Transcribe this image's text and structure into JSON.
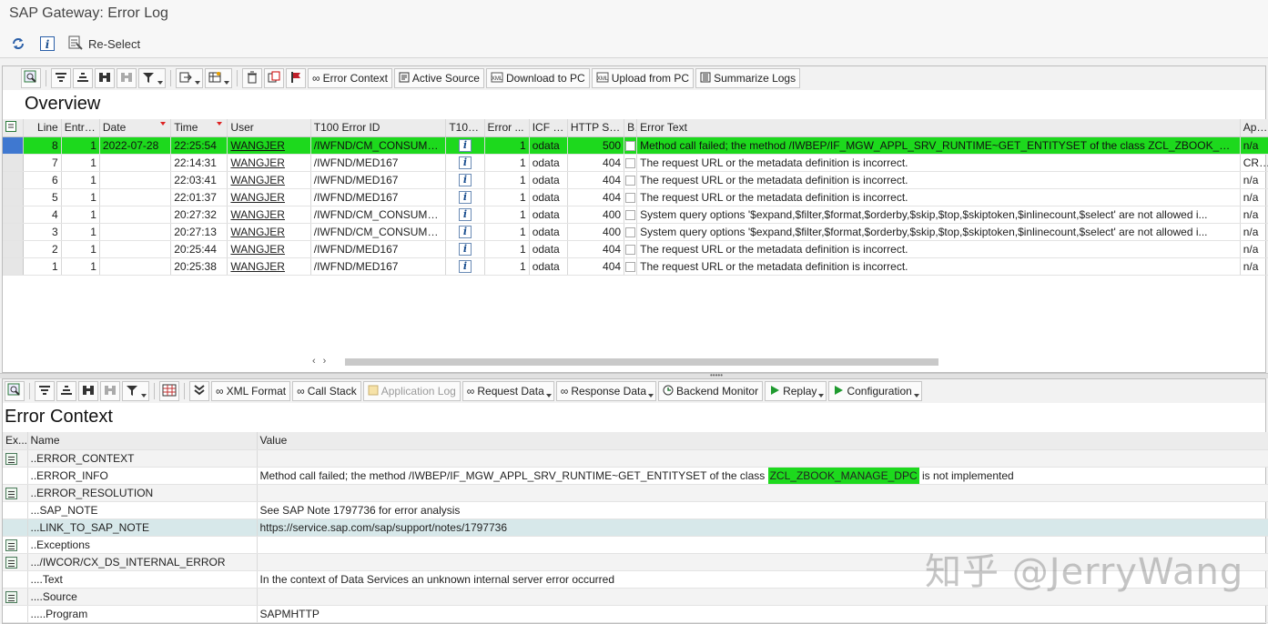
{
  "window": {
    "title": "SAP Gateway: Error Log"
  },
  "app_toolbar": {
    "reselect_label": "Re-Select"
  },
  "top_toolbar": {
    "error_context": "Error Context",
    "active_source": "Active Source",
    "download_to_pc": "Download to PC",
    "upload_from_pc": "Upload from PC",
    "summarize_logs": "Summarize Logs"
  },
  "overview": {
    "title": "Overview",
    "columns": [
      "Line",
      "Entry...",
      "Date",
      "Time",
      "User",
      "T100 Error ID",
      "T100...",
      "Error ...",
      "ICF N...",
      "HTTP St...",
      "Ba",
      "Error Text",
      "Applica"
    ],
    "rows": [
      {
        "line": "8",
        "entry": "1",
        "date": "2022-07-28",
        "time": "22:25:54",
        "user": "WANGJER",
        "t100_id": "/IWFND/CM_CONSUMER...",
        "err_no": "1",
        "icf": "odata",
        "http": "500",
        "text": "Method call failed; the method /IWBEP/IF_MGW_APPL_SRV_RUNTIME~GET_ENTITYSET of the class ZCL_ZBOOK_M...",
        "app": "n/a",
        "selected": true
      },
      {
        "line": "7",
        "entry": "1",
        "date": "",
        "time": "22:14:31",
        "user": "WANGJER",
        "t100_id": "/IWFND/MED167",
        "err_no": "1",
        "icf": "odata",
        "http": "404",
        "text": "The request URL or the metadata definition is incorrect.",
        "app": "CRM-B"
      },
      {
        "line": "6",
        "entry": "1",
        "date": "",
        "time": "22:03:41",
        "user": "WANGJER",
        "t100_id": "/IWFND/MED167",
        "err_no": "1",
        "icf": "odata",
        "http": "404",
        "text": "The request URL or the metadata definition is incorrect.",
        "app": "n/a"
      },
      {
        "line": "5",
        "entry": "1",
        "date": "",
        "time": "22:01:37",
        "user": "WANGJER",
        "t100_id": "/IWFND/MED167",
        "err_no": "1",
        "icf": "odata",
        "http": "404",
        "text": "The request URL or the metadata definition is incorrect.",
        "app": "n/a"
      },
      {
        "line": "4",
        "entry": "1",
        "date": "",
        "time": "20:27:32",
        "user": "WANGJER",
        "t100_id": "/IWFND/CM_CONSUMER...",
        "err_no": "1",
        "icf": "odata",
        "http": "400",
        "text": "System query options '$expand,$filter,$format,$orderby,$skip,$top,$skiptoken,$inlinecount,$select' are not allowed i...",
        "app": "n/a"
      },
      {
        "line": "3",
        "entry": "1",
        "date": "",
        "time": "20:27:13",
        "user": "WANGJER",
        "t100_id": "/IWFND/CM_CONSUMER...",
        "err_no": "1",
        "icf": "odata",
        "http": "400",
        "text": "System query options '$expand,$filter,$format,$orderby,$skip,$top,$skiptoken,$inlinecount,$select' are not allowed i...",
        "app": "n/a"
      },
      {
        "line": "2",
        "entry": "1",
        "date": "",
        "time": "20:25:44",
        "user": "WANGJER",
        "t100_id": "/IWFND/MED167",
        "err_no": "1",
        "icf": "odata",
        "http": "404",
        "text": "The request URL or the metadata definition is incorrect.",
        "app": "n/a"
      },
      {
        "line": "1",
        "entry": "1",
        "date": "",
        "time": "20:25:38",
        "user": "WANGJER",
        "t100_id": "/IWFND/MED167",
        "err_no": "1",
        "icf": "odata",
        "http": "404",
        "text": "The request URL or the metadata definition is incorrect.",
        "app": "n/a"
      }
    ]
  },
  "bottom_toolbar": {
    "xml_format": "XML Format",
    "call_stack": "Call Stack",
    "application_log": "Application Log",
    "request_data": "Request Data",
    "response_data": "Response Data",
    "backend_monitor": "Backend Monitor",
    "replay": "Replay",
    "configuration": "Configuration"
  },
  "error_context": {
    "title": "Error Context",
    "columns": [
      "Ex...",
      "Name",
      "Value"
    ],
    "rows": [
      {
        "icon": true,
        "name": "..ERROR_CONTEXT",
        "value": ""
      },
      {
        "icon": false,
        "name": "..ERROR_INFO",
        "value_pre": "Method call failed; the method /IWBEP/IF_MGW_APPL_SRV_RUNTIME~GET_ENTITYSET of the class ",
        "value_highlight": "ZCL_ZBOOK_MANAGE_DPC",
        "value_post": " is not implemented"
      },
      {
        "icon": true,
        "name": "..ERROR_RESOLUTION",
        "value": ""
      },
      {
        "icon": false,
        "name": "...SAP_NOTE",
        "value": "See SAP Note 1797736 for error analysis"
      },
      {
        "icon": false,
        "name": "...LINK_TO_SAP_NOTE",
        "value": "https://service.sap.com/sap/support/notes/1797736"
      },
      {
        "icon": true,
        "name": "..Exceptions",
        "value": ""
      },
      {
        "icon": true,
        "name": ".../IWCOR/CX_DS_INTERNAL_ERROR",
        "value": ""
      },
      {
        "icon": false,
        "name": "....Text",
        "value": "In the context of Data Services an unknown internal server error occurred"
      },
      {
        "icon": true,
        "name": "....Source",
        "value": ""
      },
      {
        "icon": false,
        "name": ".....Program",
        "value": "SAPMHTTP"
      }
    ]
  },
  "watermark": "知乎 @JerryWang",
  "colors": {
    "selected_row": "#1dd91d",
    "link_row": "#d7e8ea",
    "accent_blue": "#3f78d0"
  }
}
